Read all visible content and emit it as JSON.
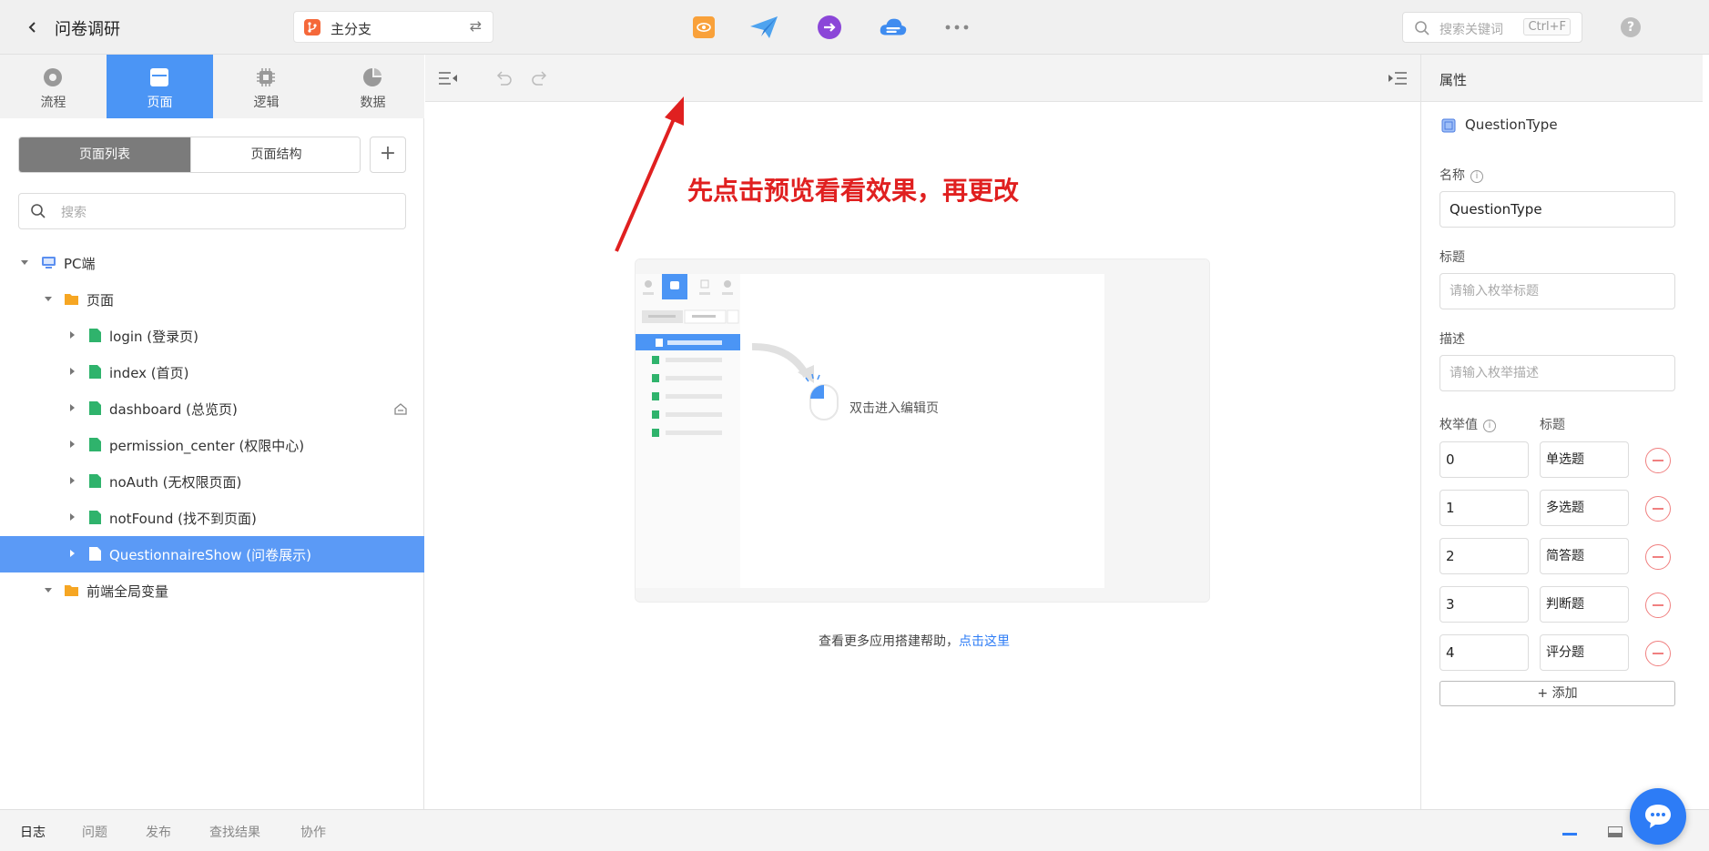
{
  "topbar": {
    "title": "问卷调研",
    "branch": "主分支",
    "search_placeholder": "搜索关键词",
    "search_shortcut": "Ctrl+F",
    "help": "?"
  },
  "left": {
    "tabs": [
      {
        "label": "流程"
      },
      {
        "label": "页面"
      },
      {
        "label": "逻辑"
      },
      {
        "label": "数据"
      }
    ],
    "segment": {
      "list": "页面列表",
      "structure": "页面结构"
    },
    "add": "+",
    "search_placeholder": "搜索",
    "tree": [
      {
        "label": "PC端"
      },
      {
        "label": "页面"
      },
      {
        "label": "login (登录页)"
      },
      {
        "label": "index (首页)"
      },
      {
        "label": "dashboard (总览页)"
      },
      {
        "label": "permission_center (权限中心)"
      },
      {
        "label": "noAuth (无权限页面)"
      },
      {
        "label": "notFound (找不到页面)"
      },
      {
        "label": "QuestionnaireShow (问卷展示)"
      },
      {
        "label": "前端全局变量"
      }
    ]
  },
  "center": {
    "annotation": "先点击预览看看效果，再更改",
    "illustration_hint": "双击进入编辑页",
    "help_text": "查看更多应用搭建帮助，",
    "help_link": "点击这里"
  },
  "right": {
    "header": "属性",
    "type_name": "QuestionType",
    "name_label": "名称",
    "name_value": "QuestionType",
    "title_label": "标题",
    "title_placeholder": "请输入枚举标题",
    "desc_label": "描述",
    "desc_placeholder": "请输入枚举描述",
    "enum_value_label": "枚举值",
    "enum_title_label": "标题",
    "enums": [
      {
        "value": "0",
        "title": "单选题"
      },
      {
        "value": "1",
        "title": "多选题"
      },
      {
        "value": "2",
        "title": "简答题"
      },
      {
        "value": "3",
        "title": "判断题"
      },
      {
        "value": "4",
        "title": "评分题"
      }
    ],
    "add_label": "+ 添加"
  },
  "bottom": {
    "tabs": [
      {
        "label": "日志"
      },
      {
        "label": "问题"
      },
      {
        "label": "发布"
      },
      {
        "label": "查找结果"
      },
      {
        "label": "协作"
      }
    ]
  },
  "colors": {
    "accent": "#4b95f5",
    "selected_row": "#5b9af6",
    "annotation": "#e02020",
    "link": "#2d7cf6",
    "page_icon": "#2fb36c",
    "folder_icon": "#f6a623"
  }
}
